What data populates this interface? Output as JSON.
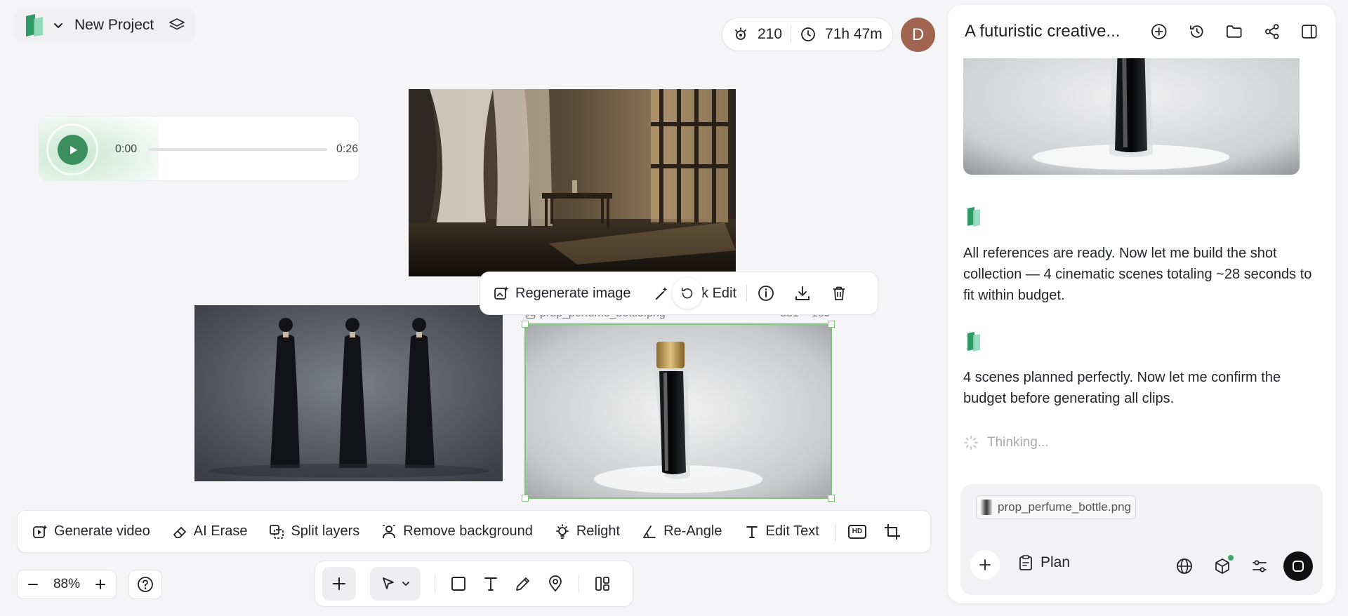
{
  "header": {
    "project_name": "New Project",
    "credits": "210",
    "time_left": "71h 47m",
    "avatar_initial": "D"
  },
  "audio": {
    "current_time": "0:00",
    "duration": "0:26",
    "progress": 0
  },
  "canvas": {
    "selected_filename": "prop_perfume_bottle.png",
    "selected_dims": "331 × 189"
  },
  "image_toolbar": {
    "regenerate": "Regenerate image",
    "quick_edit": "ick Edit"
  },
  "edit_toolbar": {
    "generate_video": "Generate video",
    "ai_erase": "AI Erase",
    "split_layers": "Split layers",
    "remove_background": "Remove background",
    "relight": "Relight",
    "re_angle": "Re-Angle",
    "edit_text": "Edit Text",
    "hd_badge": "HD"
  },
  "zoom": {
    "level": "88%"
  },
  "panel": {
    "title": "A futuristic creative...",
    "message1": "All references are ready. Now let me build the shot collection — 4 cinematic scenes totaling ~28 seconds to fit within budget.",
    "message2": "4 scenes planned perfectly. Now let me confirm the budget before generating all clips.",
    "thinking": "Thinking...",
    "attachment_name": "prop_perfume_bottle.png",
    "plan_label": "Plan"
  },
  "colors": {
    "accent_green": "#7ec47a",
    "brand_green": "#3aa66b",
    "avatar_bg": "#a06450"
  }
}
